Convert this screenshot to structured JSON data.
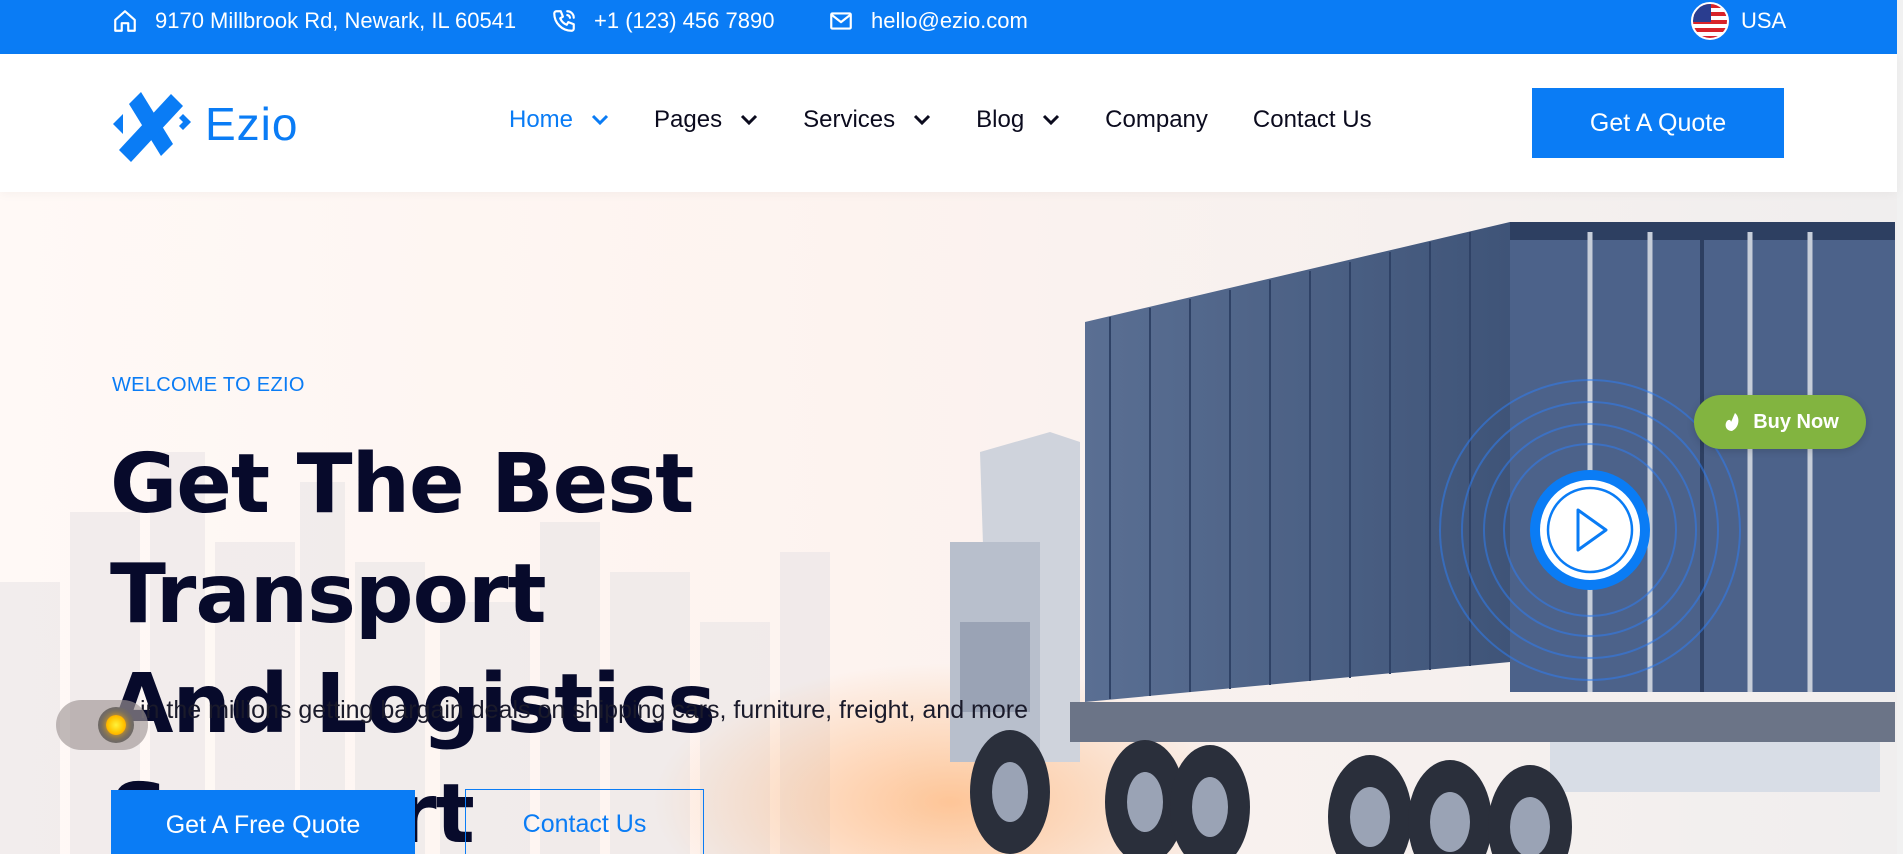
{
  "topbar": {
    "address": "9170 Millbrook Rd, Newark, IL 60541",
    "phone": "+1 (123) 456 7890",
    "email": "hello@ezio.com",
    "language": "USA"
  },
  "header": {
    "logo_text": "Ezio",
    "nav": [
      {
        "label": "Home",
        "active": true,
        "dropdown": true
      },
      {
        "label": "Pages",
        "active": false,
        "dropdown": true
      },
      {
        "label": "Services",
        "active": false,
        "dropdown": true
      },
      {
        "label": "Blog",
        "active": false,
        "dropdown": true
      },
      {
        "label": "Company",
        "active": false,
        "dropdown": false
      },
      {
        "label": "Contact Us",
        "active": false,
        "dropdown": false
      }
    ],
    "cta_label": "Get A Quote"
  },
  "hero": {
    "eyebrow": "WELCOME TO EZIO",
    "title_line1": "Get The Best Transport",
    "title_line2": "And Logistics Support",
    "subtitle": "in the millions getting bargain deals on shipping cars, furniture, freight, and more",
    "primary_button": "Get A Free Quote",
    "secondary_button": "Contact Us",
    "buy_now_label": "Buy Now"
  },
  "colors": {
    "brand_blue": "#0a7cf5",
    "heading_navy": "#070a2b",
    "buy_now_green": "#82b440"
  },
  "icons": [
    "home-icon",
    "phone-icon",
    "mail-icon",
    "usa-flag-icon",
    "chevron-down-icon",
    "play-icon",
    "envato-leaf-icon",
    "sun-icon"
  ]
}
